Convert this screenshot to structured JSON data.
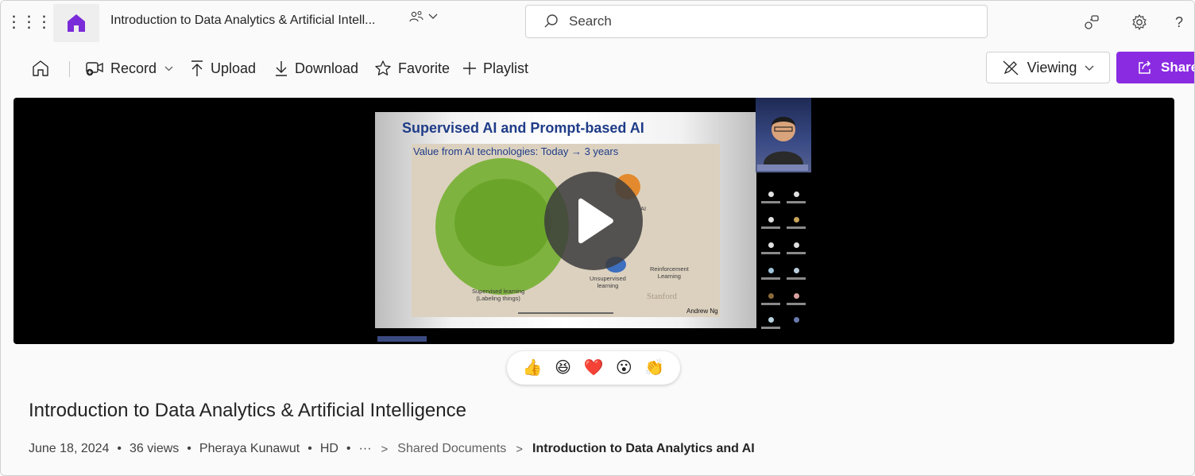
{
  "header": {
    "waffle_glyph": "⋮⋮⋮",
    "title": "Introduction to Data Analytics & Artificial Intell...",
    "search": {
      "placeholder": "Search"
    }
  },
  "toolbar": {
    "record_label": "Record",
    "upload_label": "Upload",
    "download_label": "Download",
    "favorite_label": "Favorite",
    "playlist_label": "Playlist",
    "viewing_label": "Viewing",
    "share_label": "Share"
  },
  "video": {
    "slide_title": "Supervised AI and Prompt-based AI",
    "slide_subtitle": "Value from AI technologies: Today → 3 years",
    "label_supervised": "Supervised learning\n(Labeling things)",
    "label_unsupervised": "Unsupervised\nlearning",
    "label_reinforcement": "Reinforcement\nLearning",
    "label_ai": "AI",
    "watermark": "Stanford",
    "author": "Andrew Ng"
  },
  "reactions": [
    {
      "name": "thumbs-up",
      "glyph": "👍"
    },
    {
      "name": "laugh",
      "glyph": "😆"
    },
    {
      "name": "heart",
      "glyph": "❤️"
    },
    {
      "name": "surprised",
      "glyph": "😮"
    },
    {
      "name": "clap",
      "glyph": "👏"
    }
  ],
  "info": {
    "title": "Introduction to Data Analytics & Artificial Intelligence",
    "date": "June 18, 2024",
    "views": "36 views",
    "owner": "Pheraya Kunawut",
    "quality": "HD",
    "ellipsis": "···",
    "breadcrumb_parent": "Shared Documents",
    "breadcrumb_current": "Introduction to Data Analytics and AI"
  },
  "colors": {
    "accent": "#8a2be2",
    "home_app": "#7a2bd9"
  }
}
